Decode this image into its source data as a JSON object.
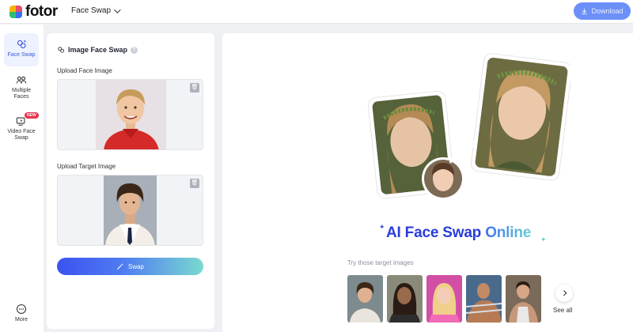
{
  "app": {
    "logo_text": "fotor",
    "brand_colors": [
      "#f5b400",
      "#ea4d6d",
      "#2fbf71",
      "#3b6cf6"
    ]
  },
  "header": {
    "product_label": "Face Swap",
    "download_label": "Download"
  },
  "rail": {
    "items": [
      {
        "label": "Face Swap",
        "icon": "face-swap-icon",
        "active": true
      },
      {
        "label": "Multiple Faces",
        "icon": "group-icon"
      },
      {
        "label": "Video Face Swap",
        "icon": "video-icon",
        "badge": "NEW"
      },
      {
        "label": "More",
        "icon": "more-icon"
      }
    ]
  },
  "panel": {
    "title": "Image Face Swap",
    "upload_face_label": "Upload Face Image",
    "upload_target_label": "Upload Target Image",
    "swap_label": "Swap"
  },
  "hero": {
    "title_part1": "AI Face Swap",
    "title_part2": "Online",
    "try_label": "Try those target images",
    "see_all": "See all"
  },
  "colors": {
    "accent": "#3b6cf6",
    "title_blue": "#2a3cd8",
    "badge_red": "#e8344e"
  }
}
